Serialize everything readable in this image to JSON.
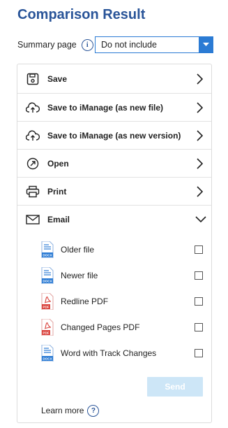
{
  "title": "Comparison Result",
  "summary": {
    "label": "Summary page",
    "info_icon": "i",
    "selected": "Do not include"
  },
  "actions": [
    {
      "label": "Save",
      "icon": "save-icon"
    },
    {
      "label": "Save to iManage (as new file)",
      "icon": "cloud-upload-icon"
    },
    {
      "label": "Save to iManage (as new version)",
      "icon": "cloud-upload-icon"
    },
    {
      "label": "Open",
      "icon": "open-external-icon"
    },
    {
      "label": "Print",
      "icon": "printer-icon"
    },
    {
      "label": "Email",
      "icon": "envelope-icon",
      "expanded": true
    }
  ],
  "email_files": [
    {
      "label": "Older file",
      "type": "DOCX",
      "checked": false
    },
    {
      "label": "Newer file",
      "type": "DOCX",
      "checked": false
    },
    {
      "label": "Redline PDF",
      "type": "PDF",
      "checked": false
    },
    {
      "label": "Changed Pages PDF",
      "type": "PDF",
      "checked": false
    },
    {
      "label": "Word with Track Changes",
      "type": "DOCX",
      "checked": false
    }
  ],
  "send_label": "Send",
  "learn_more": {
    "label": "Learn more",
    "icon_text": "?"
  },
  "colors": {
    "accent": "#2a5599",
    "dropdown": "#2b7bd4",
    "send_disabled": "#cde6f7",
    "docx": "#2b7bd4",
    "pdf": "#d9413b"
  }
}
